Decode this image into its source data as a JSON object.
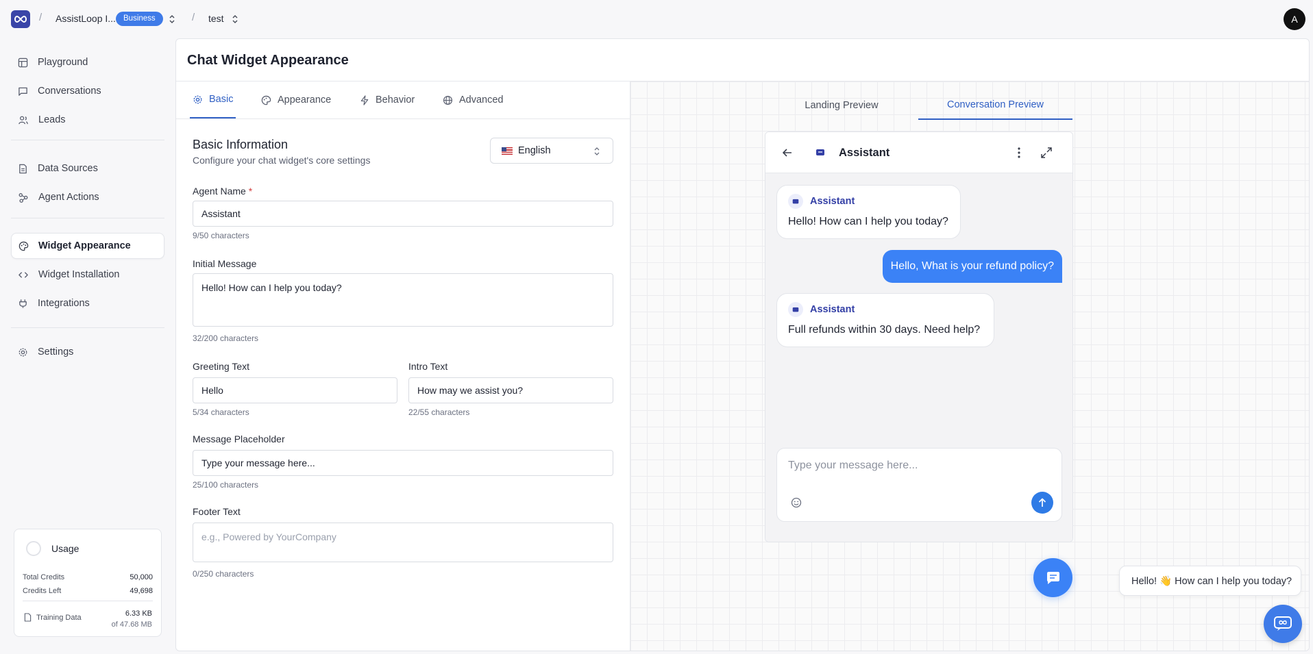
{
  "header": {
    "org_name": "AssistLoop I...",
    "plan_badge": "Business",
    "project_name": "test",
    "separator": "/",
    "avatar_initial": "A"
  },
  "sidebar": {
    "items": [
      {
        "label": "Playground",
        "icon": "layout-icon"
      },
      {
        "label": "Conversations",
        "icon": "message-square-icon"
      },
      {
        "label": "Leads",
        "icon": "users-icon"
      },
      {
        "label": "Data Sources",
        "icon": "file-text-icon"
      },
      {
        "label": "Agent Actions",
        "icon": "workflow-icon"
      },
      {
        "label": "Widget Appearance",
        "icon": "palette-icon",
        "active": true
      },
      {
        "label": "Widget Installation",
        "icon": "code-icon"
      },
      {
        "label": "Integrations",
        "icon": "plug-icon"
      },
      {
        "label": "Settings",
        "icon": "gear-icon"
      }
    ]
  },
  "usage": {
    "title": "Usage",
    "total_credits_label": "Total Credits",
    "total_credits_value": "50,000",
    "credits_left_label": "Credits Left",
    "credits_left_value": "49,698",
    "training_label": "Training Data",
    "training_used": "6.33 KB",
    "training_total": "of 47.68 MB"
  },
  "main": {
    "title": "Chat Widget Appearance",
    "tabs": [
      {
        "label": "Basic",
        "active": true
      },
      {
        "label": "Appearance"
      },
      {
        "label": "Behavior"
      },
      {
        "label": "Advanced"
      }
    ],
    "section_title": "Basic Information",
    "section_subtitle": "Configure your chat widget's core settings",
    "language": "English",
    "fields": {
      "agent_name": {
        "label": "Agent Name",
        "required_mark": "*",
        "value": "Assistant",
        "counter": "9/50 characters"
      },
      "initial_message": {
        "label": "Initial Message",
        "value": "Hello! How can I help you today?",
        "counter": "32/200 characters"
      },
      "greeting_text": {
        "label": "Greeting Text",
        "value": "Hello",
        "counter": "5/34 characters"
      },
      "intro_text": {
        "label": "Intro Text",
        "value": "How may we assist you?",
        "counter": "22/55 characters"
      },
      "message_placeholder": {
        "label": "Message Placeholder",
        "value": "Type your message here...",
        "counter": "25/100 characters"
      },
      "footer_text": {
        "label": "Footer Text",
        "value": "",
        "placeholder": "e.g., Powered by YourCompany",
        "counter": "0/250 characters"
      }
    }
  },
  "preview": {
    "tabs": [
      {
        "label": "Landing Preview"
      },
      {
        "label": "Conversation Preview",
        "active": true
      }
    ],
    "widget_title": "Assistant",
    "messages": [
      {
        "from": "bot",
        "name": "Assistant",
        "text": "Hello! How can I help you today?"
      },
      {
        "from": "user",
        "text": "Hello, What is your refund policy?"
      },
      {
        "from": "bot",
        "name": "Assistant",
        "text": "Full refunds within 30 days. Need help?"
      }
    ],
    "composer_placeholder": "Type your message here...",
    "greeting_popup": "Hello! 👋 How can I help you today?"
  },
  "colors": {
    "accent": "#2f5fc4",
    "user_bubble": "#3b82f6",
    "brand": "#3a45a8"
  }
}
